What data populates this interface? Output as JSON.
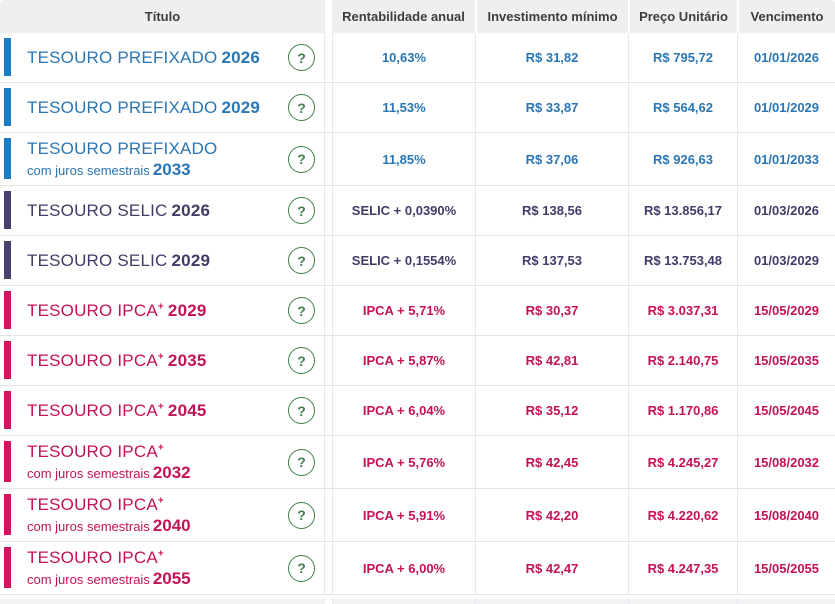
{
  "table": {
    "header": {
      "titulo": "Título",
      "rentabilidade": "Rentabilidade anual",
      "investimento": "Investimento mínimo",
      "preco": "Preço Unitário",
      "vencimento": "Vencimento"
    },
    "help_icon": "?",
    "colors": {
      "prefixado_bar": "#1d7dc4",
      "prefixado_text": "#2a76b5",
      "selic_bar": "#49406f",
      "selic_text": "#433a68",
      "ipca_bar": "#d31260",
      "ipca_text": "#c41258",
      "help_green": "#41804b",
      "header_bg": "#f0efef"
    },
    "rows": [
      {
        "type": "prefixado",
        "line1": "TESOURO PREFIXADO",
        "sup": "",
        "line1_year": "2026",
        "line2": "",
        "line2_year": "",
        "rent": "10,63%",
        "inv": "R$ 31,82",
        "preco": "R$ 795,72",
        "venc": "01/01/2026"
      },
      {
        "type": "prefixado",
        "line1": "TESOURO PREFIXADO",
        "sup": "",
        "line1_year": "2029",
        "line2": "",
        "line2_year": "",
        "rent": "11,53%",
        "inv": "R$ 33,87",
        "preco": "R$ 564,62",
        "venc": "01/01/2029"
      },
      {
        "type": "prefixado",
        "line1": "TESOURO PREFIXADO",
        "sup": "",
        "line1_year": "",
        "line2": "com juros semestrais",
        "line2_year": "2033",
        "rent": "11,85%",
        "inv": "R$ 37,06",
        "preco": "R$ 926,63",
        "venc": "01/01/2033"
      },
      {
        "type": "selic",
        "line1": "TESOURO SELIC",
        "sup": "",
        "line1_year": "2026",
        "line2": "",
        "line2_year": "",
        "rent": "SELIC + 0,0390%",
        "inv": "R$ 138,56",
        "preco": "R$ 13.856,17",
        "venc": "01/03/2026"
      },
      {
        "type": "selic",
        "line1": "TESOURO SELIC",
        "sup": "",
        "line1_year": "2029",
        "line2": "",
        "line2_year": "",
        "rent": "SELIC + 0,1554%",
        "inv": "R$ 137,53",
        "preco": "R$ 13.753,48",
        "venc": "01/03/2029"
      },
      {
        "type": "ipca",
        "line1": "TESOURO IPCA",
        "sup": "+",
        "line1_year": "2029",
        "line2": "",
        "line2_year": "",
        "rent": "IPCA + 5,71%",
        "inv": "R$ 30,37",
        "preco": "R$ 3.037,31",
        "venc": "15/05/2029"
      },
      {
        "type": "ipca",
        "line1": "TESOURO IPCA",
        "sup": "+",
        "line1_year": "2035",
        "line2": "",
        "line2_year": "",
        "rent": "IPCA + 5,87%",
        "inv": "R$ 42,81",
        "preco": "R$ 2.140,75",
        "venc": "15/05/2035"
      },
      {
        "type": "ipca",
        "line1": "TESOURO IPCA",
        "sup": "+",
        "line1_year": "2045",
        "line2": "",
        "line2_year": "",
        "rent": "IPCA + 6,04%",
        "inv": "R$ 35,12",
        "preco": "R$ 1.170,86",
        "venc": "15/05/2045"
      },
      {
        "type": "ipca",
        "line1": "TESOURO IPCA",
        "sup": "+",
        "line1_year": "",
        "line2": "com juros semestrais",
        "line2_year": "2032",
        "rent": "IPCA + 5,76%",
        "inv": "R$ 42,45",
        "preco": "R$ 4.245,27",
        "venc": "15/08/2032"
      },
      {
        "type": "ipca",
        "line1": "TESOURO IPCA",
        "sup": "+",
        "line1_year": "",
        "line2": "com juros semestrais",
        "line2_year": "2040",
        "rent": "IPCA + 5,91%",
        "inv": "R$ 42,20",
        "preco": "R$ 4.220,62",
        "venc": "15/08/2040"
      },
      {
        "type": "ipca",
        "line1": "TESOURO IPCA",
        "sup": "+",
        "line1_year": "",
        "line2": "com juros semestrais",
        "line2_year": "2055",
        "rent": "IPCA + 6,00%",
        "inv": "R$ 42,47",
        "preco": "R$ 4.247,35",
        "venc": "15/05/2055"
      }
    ]
  }
}
